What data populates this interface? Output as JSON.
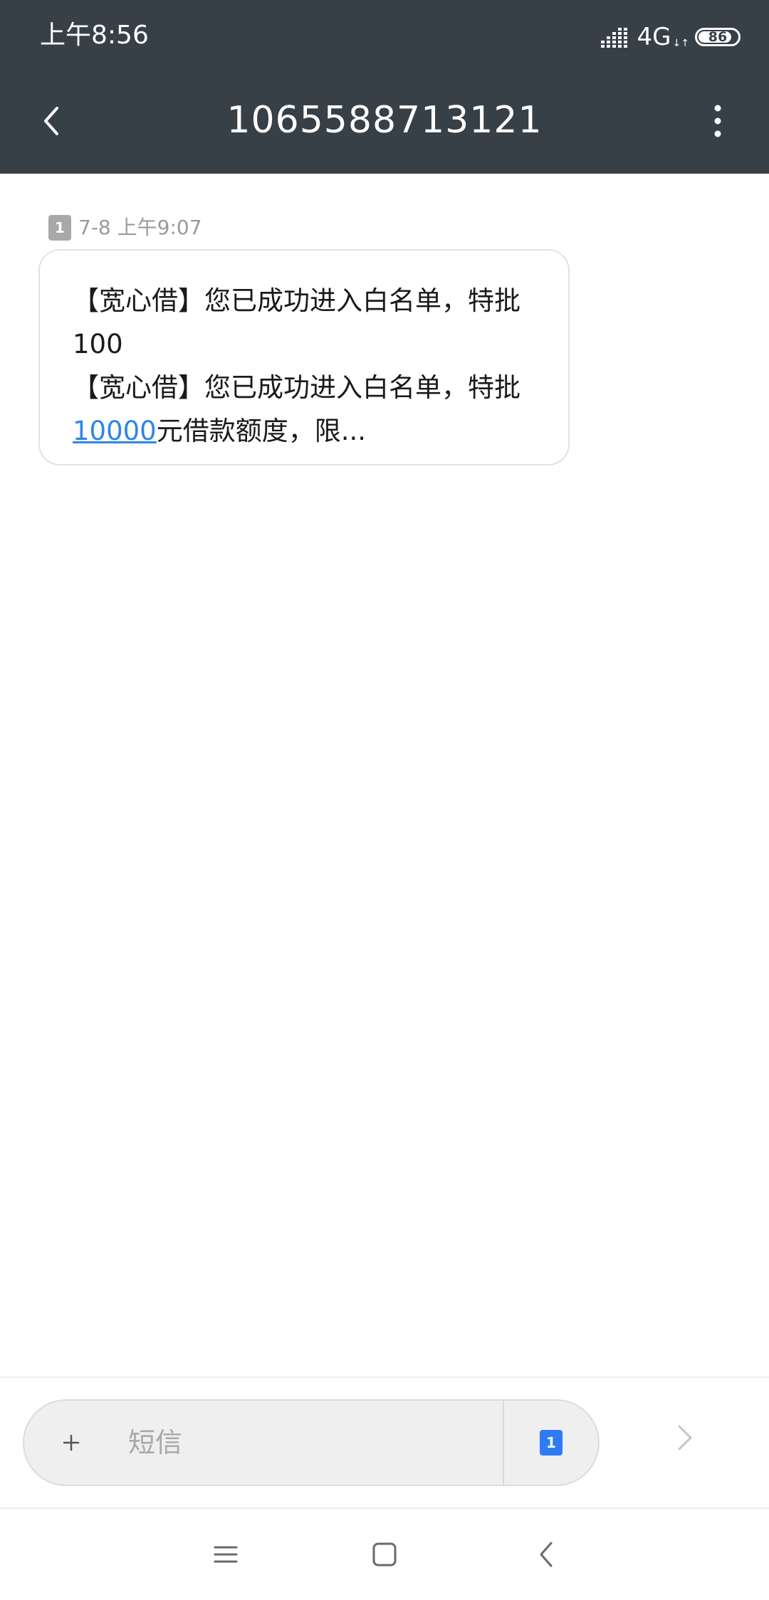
{
  "status_bar": {
    "time": "上午8:56",
    "network": "4G",
    "network_arrows": "↓↑",
    "battery": "86",
    "battery_level": 0.86
  },
  "header": {
    "title": "1065588713121",
    "back_icon": "chevron-left-icon",
    "menu_icon": "more-vertical-icon"
  },
  "message": {
    "sim": "1",
    "timestamp": "7-8 上午9:07",
    "lines": {
      "l1": "【宽心借】您已成功进入白名单，特批",
      "l2": "100",
      "l3": "【宽心借】您已成功进入白名单，特批",
      "l4_link": "10000",
      "l4_rest": "元借款额度，限..."
    }
  },
  "compose": {
    "placeholder": "短信",
    "sim": "1",
    "plus_icon": "plus-icon",
    "send_icon": "send-icon"
  },
  "nav": {
    "menu_icon": "menu-icon",
    "home_icon": "home-icon",
    "back_icon": "back-icon"
  },
  "colors": {
    "header_bg": "#373f47",
    "link": "#2f86e6",
    "sim_badge": "#a8a8a8",
    "sim_select_badge": "#2f7bf5"
  }
}
